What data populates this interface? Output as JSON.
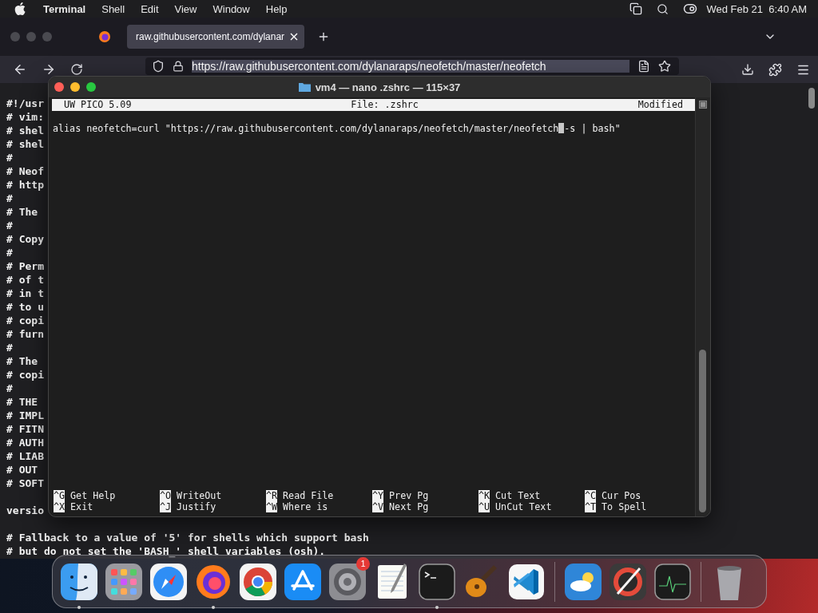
{
  "menubar": {
    "app": "Terminal",
    "menus": [
      "Shell",
      "Edit",
      "View",
      "Window",
      "Help"
    ],
    "clock": "Wed Feb 21  6:40 AM"
  },
  "browser": {
    "tab": {
      "title": "raw.githubusercontent.com/dylanar"
    },
    "url": "https://raw.githubusercontent.com/dylanaraps/neofetch/master/neofetch",
    "lines": [
      {
        "kind": "text",
        "text": "#!/usr"
      },
      {
        "kind": "text",
        "text": "# vim:"
      },
      {
        "kind": "text",
        "text": "# shel"
      },
      {
        "kind": "text",
        "text": "# shel"
      },
      {
        "kind": "text",
        "text": "#"
      },
      {
        "kind": "text",
        "text": "# Neof"
      },
      {
        "kind": "text",
        "text": "# http"
      },
      {
        "kind": "text",
        "text": "#"
      },
      {
        "kind": "text",
        "text": "# The"
      },
      {
        "kind": "text",
        "text": "#"
      },
      {
        "kind": "text",
        "text": "# Copy"
      },
      {
        "kind": "text",
        "text": "#"
      },
      {
        "kind": "text",
        "text": "# Perm"
      },
      {
        "kind": "text",
        "text": "# of t"
      },
      {
        "kind": "text",
        "text": "# in t"
      },
      {
        "kind": "text",
        "text": "# to u"
      },
      {
        "kind": "text",
        "text": "# copi"
      },
      {
        "kind": "text",
        "text": "# furn"
      },
      {
        "kind": "text",
        "text": "#"
      },
      {
        "kind": "text",
        "text": "# The"
      },
      {
        "kind": "text",
        "text": "# copi"
      },
      {
        "kind": "text",
        "text": "#"
      },
      {
        "kind": "text",
        "text": "# THE"
      },
      {
        "kind": "text",
        "text": "# IMPL"
      },
      {
        "kind": "text",
        "text": "# FITN"
      },
      {
        "kind": "text",
        "text": "# AUTH"
      },
      {
        "kind": "text",
        "text": "# LIAB"
      },
      {
        "kind": "text",
        "text": "# OUT"
      },
      {
        "kind": "text",
        "text": "# SOFT"
      },
      {
        "kind": "blank"
      },
      {
        "kind": "text",
        "text": "versio"
      },
      {
        "kind": "blank"
      },
      {
        "kind": "text",
        "text": "# Fallback to a value of '5' for shells which support bash"
      },
      {
        "kind": "text",
        "text": "# but do not set the 'BASH_' shell variables (osh)."
      }
    ]
  },
  "terminal": {
    "title": "vm4 — nano .zshrc — 115×37",
    "header": {
      "version": "UW PICO 5.09",
      "file": "File: .zshrc",
      "status": "Modified"
    },
    "line": {
      "before_cursor": "alias neofetch=curl \"https://raw.githubusercontent.com/dylanaraps/neofetch/master/neofetch",
      "after_cursor": "-s | bash\""
    },
    "shortcuts": [
      [
        {
          "key": "^G",
          "label": "Get Help"
        },
        {
          "key": "^O",
          "label": "WriteOut"
        },
        {
          "key": "^R",
          "label": "Read File"
        },
        {
          "key": "^Y",
          "label": "Prev Pg"
        },
        {
          "key": "^K",
          "label": "Cut Text"
        },
        {
          "key": "^C",
          "label": "Cur Pos"
        }
      ],
      [
        {
          "key": "^X",
          "label": "Exit"
        },
        {
          "key": "^J",
          "label": "Justify"
        },
        {
          "key": "^W",
          "label": "Where is"
        },
        {
          "key": "^V",
          "label": "Next Pg"
        },
        {
          "key": "^U",
          "label": "UnCut Text"
        },
        {
          "key": "^T",
          "label": "To Spell"
        }
      ]
    ]
  },
  "dock": {
    "groups": [
      [
        {
          "kind": "finder",
          "running": true
        },
        {
          "kind": "launchpad",
          "running": false
        },
        {
          "kind": "safari",
          "running": false
        },
        {
          "kind": "firefox",
          "running": true
        },
        {
          "kind": "chrome",
          "running": false
        },
        {
          "kind": "appstore",
          "running": false
        },
        {
          "kind": "settings",
          "running": false,
          "badge": "1"
        },
        {
          "kind": "textedit",
          "running": false
        },
        {
          "kind": "terminal",
          "running": true
        },
        {
          "kind": "garageband",
          "running": false
        },
        {
          "kind": "vscode",
          "running": false
        }
      ],
      [
        {
          "kind": "weather",
          "running": false
        },
        {
          "kind": "instruments",
          "running": false
        },
        {
          "kind": "activity",
          "running": false
        }
      ],
      [
        {
          "kind": "trash",
          "running": false
        }
      ]
    ]
  }
}
